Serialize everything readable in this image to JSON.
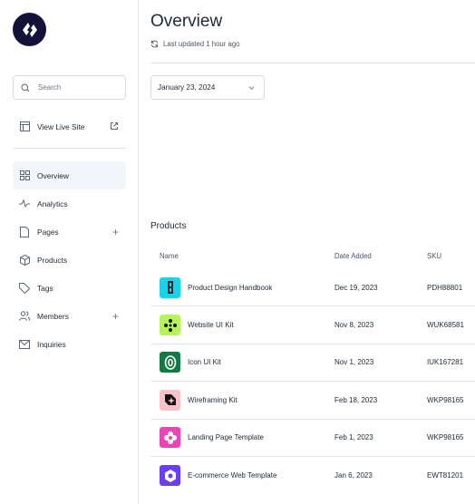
{
  "sidebar": {
    "search_placeholder": "Search",
    "view_live_site": "View Live Site",
    "items": [
      {
        "label": "Overview",
        "icon": "grid-icon",
        "active": true,
        "plus": false
      },
      {
        "label": "Analytics",
        "icon": "activity-icon",
        "plus": false
      },
      {
        "label": "Pages",
        "icon": "file-icon",
        "plus": true
      },
      {
        "label": "Products",
        "icon": "box-icon",
        "plus": false
      },
      {
        "label": "Tags",
        "icon": "tag-icon",
        "plus": false
      },
      {
        "label": "Members",
        "icon": "users-icon",
        "plus": true
      },
      {
        "label": "Inquiries",
        "icon": "mail-icon",
        "plus": false
      }
    ]
  },
  "header": {
    "title": "Overview",
    "updated": "Last updated 1 hour ago"
  },
  "date_select": {
    "value": "January 23, 2024"
  },
  "products": {
    "title": "Products",
    "columns": [
      "Name",
      "Date Added",
      "SKU"
    ],
    "rows": [
      {
        "name": "Product Design Handbook",
        "date": "Dec 19, 2023",
        "sku": "PDH88801",
        "color": "#1ad3e6"
      },
      {
        "name": "Website UI Kit",
        "date": "Nov 8, 2023",
        "sku": "WUK68581",
        "color": "#b6f25a"
      },
      {
        "name": "Icon UI Kit",
        "date": "Nov 1, 2023",
        "sku": "IUK167281",
        "color": "#147a44"
      },
      {
        "name": "Wireframing Kit",
        "date": "Feb 18, 2023",
        "sku": "WKP98165",
        "color": "#f7c2c8"
      },
      {
        "name": "Landing Page Template",
        "date": "Feb 1, 2023",
        "sku": "WKP98165",
        "color": "#e845b8"
      },
      {
        "name": "E-commerce Web Template",
        "date": "Jan 6, 2023",
        "sku": "EWT81201",
        "color": "#6b3ef0"
      }
    ]
  }
}
